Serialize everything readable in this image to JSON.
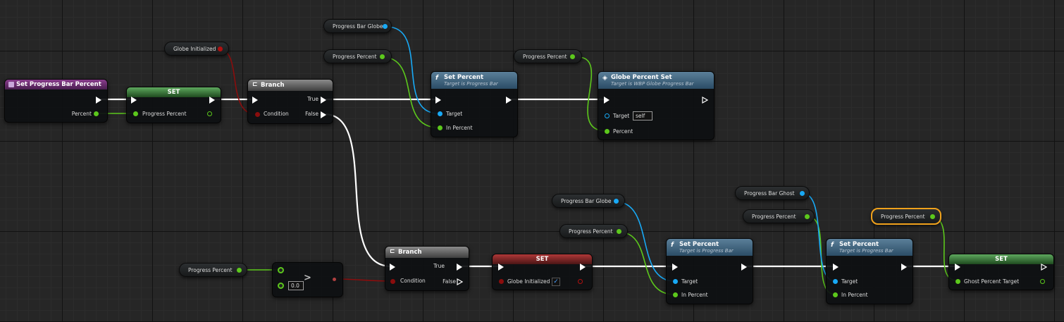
{
  "colors": {
    "exec": "#ffffff",
    "float": "#8af03c",
    "object": "#18a9f5",
    "bool": "#8a0d0d",
    "selected": "#f0a21c"
  },
  "nodes": {
    "event": {
      "title": "Set Progress Bar Percent",
      "percent_label": "Percent"
    },
    "set1": {
      "title": "SET",
      "pin_label": "Progress Percent"
    },
    "branch1": {
      "title": "Branch",
      "condition": "Condition",
      "true_label": "True",
      "false_label": "False"
    },
    "branch2": {
      "title": "Branch",
      "condition": "Condition",
      "true_label": "True",
      "false_label": "False"
    },
    "setpct1": {
      "title": "Set Percent",
      "subtitle": "Target is Progress Bar",
      "target": "Target",
      "in_percent": "In Percent"
    },
    "setpct2": {
      "title": "Set Percent",
      "subtitle": "Target is Progress Bar",
      "target": "Target",
      "in_percent": "In Percent"
    },
    "setpct3": {
      "title": "Set Percent",
      "subtitle": "Target is Progress Bar",
      "target": "Target",
      "in_percent": "In Percent"
    },
    "globeset": {
      "title": "Globe Percent Set",
      "subtitle": "Target is WBP Globe Progress Bar",
      "target": "Target",
      "target_value": "self",
      "percent": "Percent"
    },
    "set2": {
      "title": "SET",
      "pin_label": "Globe Initialized",
      "checked": "✓"
    },
    "set3": {
      "title": "SET",
      "pin_label": "Ghost Percent Target"
    },
    "compare": {
      "operator": ">",
      "value": "0.0"
    }
  },
  "vars": {
    "globe_initialized": "Globe Initialized",
    "progress_bar_globe_1": "Progress Bar Globe",
    "progress_percent_1": "Progress Percent",
    "progress_percent_2": "Progress Percent",
    "progress_percent_3": "Progress Percent",
    "progress_bar_globe_2": "Progress Bar Globe",
    "progress_percent_4": "Progress Percent",
    "progress_bar_ghost": "Progress Bar Ghost",
    "progress_percent_5": "Progress Percent",
    "progress_percent_6": "Progress Percent"
  }
}
